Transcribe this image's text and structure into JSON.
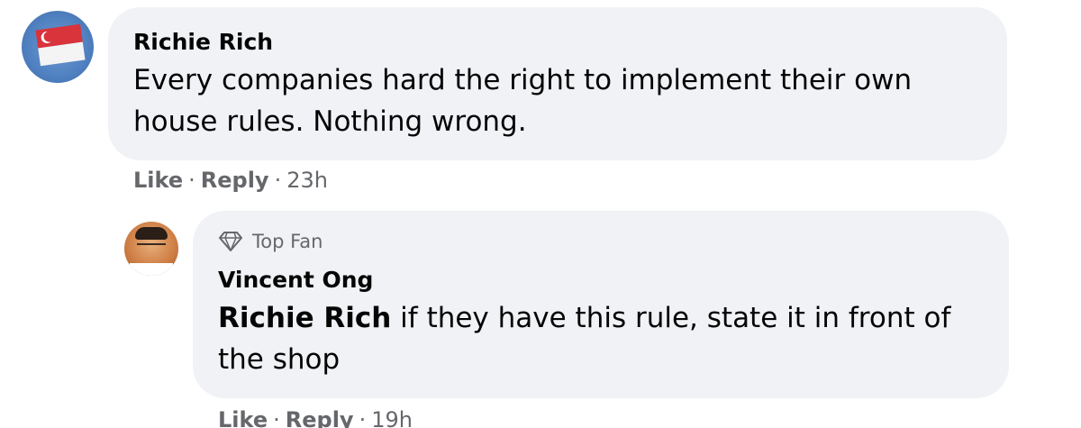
{
  "comments": [
    {
      "author": "Richie Rich",
      "text": "Every companies hard the right to implement their own house rules. Nothing wrong.",
      "actions": {
        "like": "Like",
        "reply": "Reply",
        "separator": "·",
        "time": "23h"
      },
      "avatar_icon": "singapore-flag-icon"
    }
  ],
  "reply": {
    "badge": {
      "label": "Top Fan",
      "icon": "diamond-icon"
    },
    "author": "Vincent Ong",
    "mention": "Richie Rich",
    "text": " if they have this rule, state it in front of the shop",
    "actions": {
      "like": "Like",
      "reply": "Reply",
      "separator": "·",
      "time": "19h"
    },
    "avatar_icon": "person-photo-icon"
  },
  "colors": {
    "bubble": "#f0f2f5",
    "secondary_text": "#65676b",
    "primary_text": "#050505"
  }
}
